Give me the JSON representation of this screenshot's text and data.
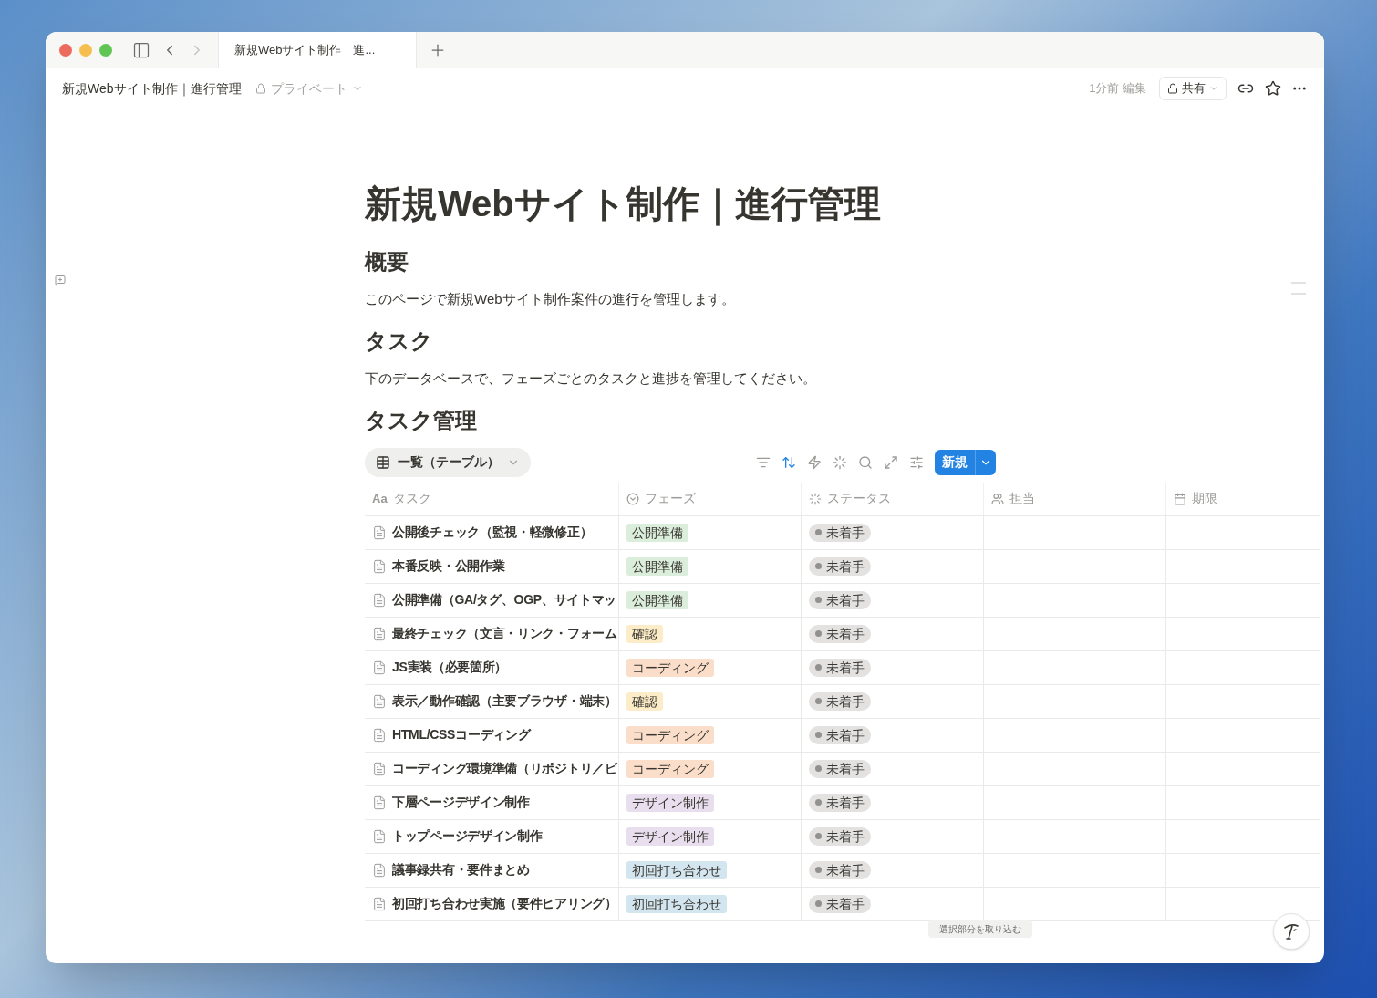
{
  "browser_tab": {
    "title": "新規Webサイト制作｜進..."
  },
  "topbar": {
    "breadcrumb": "新規Webサイト制作｜進行管理",
    "privacy": "プライベート",
    "edited": "1分前 編集",
    "share": "共有"
  },
  "page": {
    "title": "新規Webサイト制作｜進行管理",
    "blocks": [
      {
        "kind": "heading",
        "text": "概要"
      },
      {
        "kind": "paragraph",
        "text": "このページで新規Webサイト制作案件の進行を管理します。"
      },
      {
        "kind": "heading",
        "text": "タスク"
      },
      {
        "kind": "paragraph",
        "text": "下のデータベースで、フェーズごとのタスクと進捗を管理してください。"
      }
    ]
  },
  "database": {
    "title": "タスク管理",
    "view": "一覧（テーブル）",
    "new_button": "新規",
    "title_column_icon": "Aa",
    "columns": [
      "タスク",
      "フェーズ",
      "ステータス",
      "担当",
      "期限"
    ],
    "rows": [
      {
        "task": "公開後チェック（監視・軽微修正）",
        "phase": "公開準備",
        "color": "#dbeddb",
        "status": "未着手"
      },
      {
        "task": "本番反映・公開作業",
        "phase": "公開準備",
        "color": "#dbeddb",
        "status": "未着手"
      },
      {
        "task": "公開準備（GA/タグ、OGP、サイトマッ",
        "phase": "公開準備",
        "color": "#dbeddb",
        "status": "未着手"
      },
      {
        "task": "最終チェック（文言・リンク・フォーム",
        "phase": "確認",
        "color": "#fdecc8",
        "status": "未着手"
      },
      {
        "task": "JS実装（必要箇所）",
        "phase": "コーディング",
        "color": "#fadec9",
        "status": "未着手"
      },
      {
        "task": "表示／動作確認（主要ブラウザ・端末）",
        "phase": "確認",
        "color": "#fdecc8",
        "status": "未着手"
      },
      {
        "task": "HTML/CSSコーディング",
        "phase": "コーディング",
        "color": "#fadec9",
        "status": "未着手"
      },
      {
        "task": "コーディング環境準備（リポジトリ／ビ",
        "phase": "コーディング",
        "color": "#fadec9",
        "status": "未着手"
      },
      {
        "task": "下層ページデザイン制作",
        "phase": "デザイン制作",
        "color": "#e8deee",
        "status": "未着手"
      },
      {
        "task": "トップページデザイン制作",
        "phase": "デザイン制作",
        "color": "#e8deee",
        "status": "未着手"
      },
      {
        "task": "議事録共有・要件まとめ",
        "phase": "初回打ち合わせ",
        "color": "#d3e5ef",
        "status": "未着手"
      },
      {
        "task": "初回打ち合わせ実施（要件ヒアリング）",
        "phase": "初回打ち合わせ",
        "color": "#d3e5ef",
        "status": "未着手"
      }
    ]
  },
  "tooltip": "選択部分を取り込む"
}
